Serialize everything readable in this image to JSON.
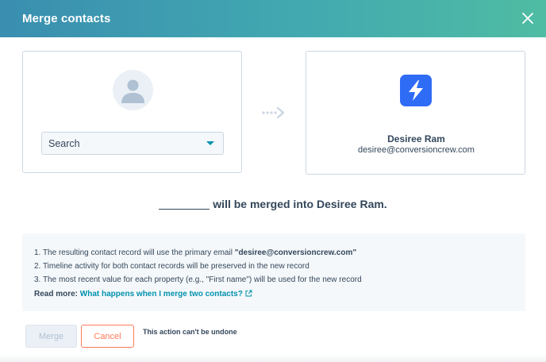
{
  "header": {
    "title": "Merge contacts",
    "close_icon": "close-icon"
  },
  "left_card": {
    "avatar_icon": "person-avatar-icon",
    "search": {
      "value": "Search",
      "caret_icon": "caret-down-icon"
    }
  },
  "arrow_icon": "dotted-arrow-right-icon",
  "right_card": {
    "logo_icon": "lightning-bolt-logo-icon",
    "name": "Desiree Ram",
    "email": "desiree@conversioncrew.com"
  },
  "merge_statement": {
    "suffix": "will be merged into Desiree Ram."
  },
  "info": {
    "line1_prefix": "1. The resulting contact record will use the primary email ",
    "line1_email": "\"desiree@conversioncrew.com\"",
    "line2": "2. Timeline activity for both contact records will be preserved in the new record",
    "line3": "3. The most recent value for each property (e.g., \"First name\") will be used for the new record",
    "read_more_label": "Read more:",
    "read_more_link": "What happens when I merge two contacts?"
  },
  "actions": {
    "merge_label": "Merge",
    "cancel_label": "Cancel",
    "note": "This action can't be undone"
  },
  "colors": {
    "header_start": "#3a8eb0",
    "header_end": "#4fbca3",
    "accent_link": "#0091ae",
    "cancel": "#ff7a59",
    "logo": "#2f6cf6",
    "text": "#33475b"
  }
}
